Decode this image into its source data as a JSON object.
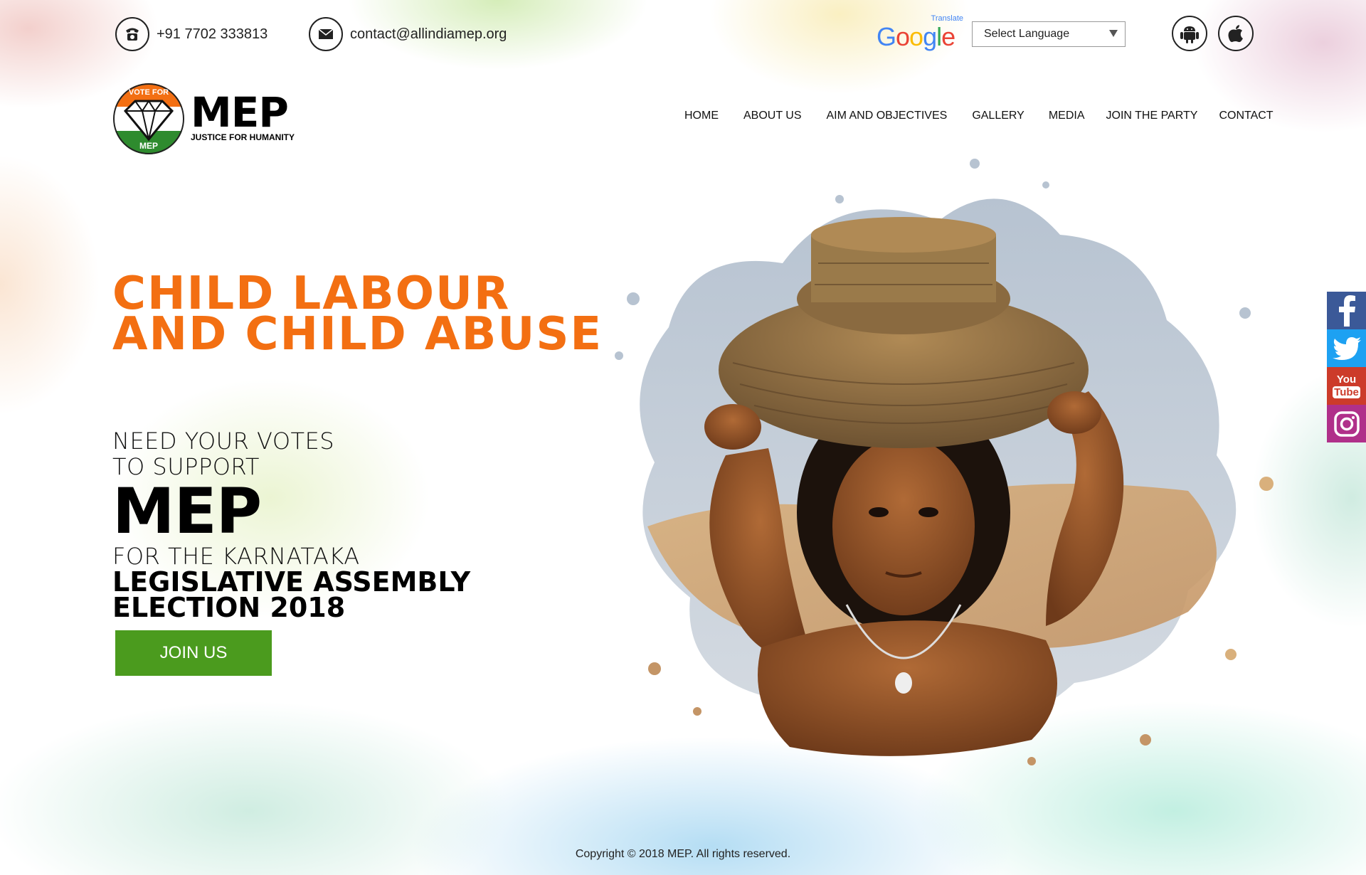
{
  "topbar": {
    "phone": "+91 7702 333813",
    "email": "contact@allindiamep.org",
    "translate_label": "Translate",
    "google_label": "Google",
    "language_select": "Select Language"
  },
  "logo": {
    "badge_top": "VOTE FOR",
    "badge_bottom": "MEP",
    "name": "MEP",
    "tagline": "JUSTICE FOR HUMANITY"
  },
  "nav": {
    "items": [
      "HOME",
      "ABOUT US",
      "AIM AND OBJECTIVES",
      "GALLERY",
      "MEDIA",
      "JOIN THE PARTY",
      "CONTACT"
    ]
  },
  "hero": {
    "headline_1": "CHILD LABOUR",
    "headline_2": "AND CHILD ABUSE",
    "line_1": "NEED YOUR VOTES",
    "line_2": "TO SUPPORT",
    "party": "MEP",
    "line_3": "FOR THE KARNATAKA",
    "line_4": "LEGISLATIVE ASSEMBLY",
    "line_5": "ELECTION 2018",
    "cta": "JOIN US"
  },
  "social": [
    "facebook",
    "twitter",
    "youtube",
    "instagram"
  ],
  "social_youtube_top": "You",
  "social_youtube_bottom": "Tube",
  "footer": {
    "copyright": "Copyright © 2018 MEP.  All rights reserved."
  },
  "colors": {
    "accent_orange": "#f36f12",
    "cta_green": "#4b9b1e",
    "facebook": "#3b5998",
    "twitter": "#1da1f2",
    "youtube": "#cc3b2a",
    "instagram": "#b0308a"
  }
}
